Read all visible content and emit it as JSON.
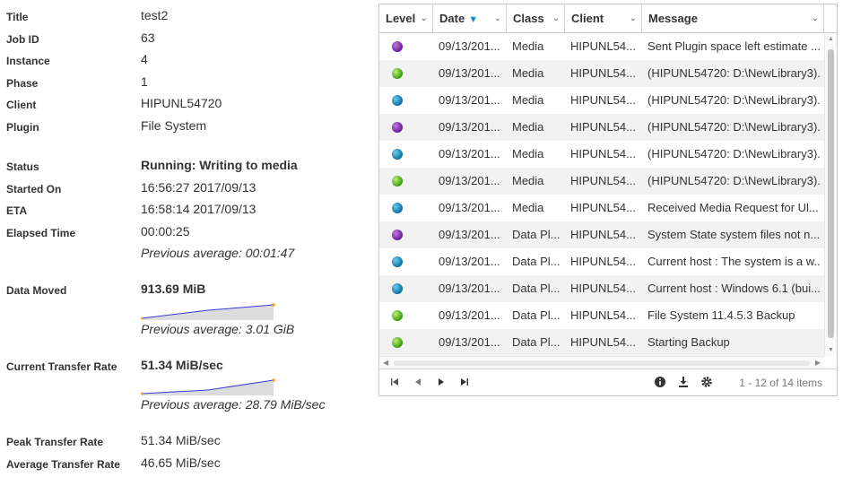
{
  "details": {
    "title_label": "Title",
    "title_value": "test2",
    "jobid_label": "Job ID",
    "jobid_value": "63",
    "instance_label": "Instance",
    "instance_value": "4",
    "phase_label": "Phase",
    "phase_value": "1",
    "client_label": "Client",
    "client_value": "HIPUNL54720",
    "plugin_label": "Plugin",
    "plugin_value": "File System",
    "status_label": "Status",
    "status_value": "Running: Writing to media",
    "started_label": "Started On",
    "started_value": "16:56:27 2017/09/13",
    "eta_label": "ETA",
    "eta_value": "16:58:14 2017/09/13",
    "elapsed_label": "Elapsed Time",
    "elapsed_value": "00:00:25",
    "elapsed_avg": "Previous average: 00:01:47",
    "moved_label": "Data Moved",
    "moved_value": "913.69 MiB",
    "moved_avg": "Previous average: 3.01 GiB",
    "rate_label": "Current Transfer Rate",
    "rate_value": "51.34 MiB/sec",
    "rate_avg": "Previous average: 28.79 MiB/sec",
    "peak_label": "Peak Transfer Rate",
    "peak_value": "51.34 MiB/sec",
    "avg_label": "Average Transfer Rate",
    "avg_value": "46.65 MiB/sec",
    "spark_line_color": "#3a3ad6",
    "spark_fill_color": "#dcdcdc",
    "spark_end_color": "#f0a020"
  },
  "grid": {
    "columns": [
      "Level",
      "Date",
      "Class",
      "Client",
      "Message"
    ],
    "sorted_column": "Date",
    "sort_direction": "descending",
    "rows": [
      {
        "level": "purple",
        "date": "09/13/201...",
        "class": "Media",
        "client": "HIPUNL54...",
        "message": "Sent Plugin space left estimate ..."
      },
      {
        "level": "green",
        "date": "09/13/201...",
        "class": "Media",
        "client": "HIPUNL54...",
        "message": "(HIPUNL54720: D:\\NewLibrary3)..."
      },
      {
        "level": "blue",
        "date": "09/13/201...",
        "class": "Media",
        "client": "HIPUNL54...",
        "message": "(HIPUNL54720: D:\\NewLibrary3)..."
      },
      {
        "level": "purple",
        "date": "09/13/201...",
        "class": "Media",
        "client": "HIPUNL54...",
        "message": "(HIPUNL54720: D:\\NewLibrary3)..."
      },
      {
        "level": "blue",
        "date": "09/13/201...",
        "class": "Media",
        "client": "HIPUNL54...",
        "message": "(HIPUNL54720: D:\\NewLibrary3)..."
      },
      {
        "level": "green",
        "date": "09/13/201...",
        "class": "Media",
        "client": "HIPUNL54...",
        "message": "(HIPUNL54720: D:\\NewLibrary3)..."
      },
      {
        "level": "blue",
        "date": "09/13/201...",
        "class": "Media",
        "client": "HIPUNL54...",
        "message": "Received Media Request for Ul..."
      },
      {
        "level": "purple",
        "date": "09/13/201...",
        "class": "Data Pl...",
        "client": "HIPUNL54...",
        "message": "System State system files not n..."
      },
      {
        "level": "blue",
        "date": "09/13/201...",
        "class": "Data Pl...",
        "client": "HIPUNL54...",
        "message": "Current host : The system is a w..."
      },
      {
        "level": "blue",
        "date": "09/13/201...",
        "class": "Data Pl...",
        "client": "HIPUNL54...",
        "message": "Current host : Windows 6.1 (bui..."
      },
      {
        "level": "green",
        "date": "09/13/201...",
        "class": "Data Pl...",
        "client": "HIPUNL54...",
        "message": "File System 11.4.5.3 Backup"
      },
      {
        "level": "green",
        "date": "09/13/201...",
        "class": "Data Pl...",
        "client": "HIPUNL54...",
        "message": "Starting Backup"
      }
    ],
    "pager_info": "1 - 12 of 14 items",
    "icons": [
      "first-page-icon",
      "prev-page-icon",
      "next-page-icon",
      "last-page-icon",
      "info-icon",
      "download-icon",
      "settings-icon"
    ]
  }
}
